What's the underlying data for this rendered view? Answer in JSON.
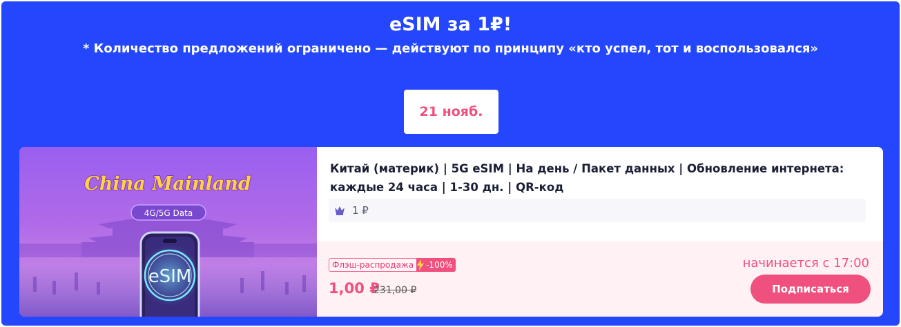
{
  "promo": {
    "title": "eSIM за 1₽!",
    "subtitle": "* Количество предложений ограничено — действуют по принципу «кто успел, тот и воспользовался»"
  },
  "date_tab": {
    "label": "21 нояб."
  },
  "product": {
    "image": {
      "caption_title": "China Mainland",
      "caption_badge": "4G/5G Data",
      "sim_label": "eSIM"
    },
    "title": "Китай (материк) | 5G eSIM | На день / Пакет данных | Обновление интернета: каждые 24 часа | 1-30 дн. | QR-код",
    "member_price": "1 ₽",
    "flash_sale_label": "Флэш-распродажа",
    "discount": "-100%",
    "price_now": "1,00 ₽",
    "price_old": "231,00 ₽",
    "starts_at": "начинается с 17:00",
    "subscribe_label": "Подписаться"
  },
  "colors": {
    "banner": "#2446fd",
    "accent": "#f0507d",
    "bottom_panel": "#fff1f4"
  },
  "icons": [
    "crown-icon",
    "lightning-icon"
  ]
}
